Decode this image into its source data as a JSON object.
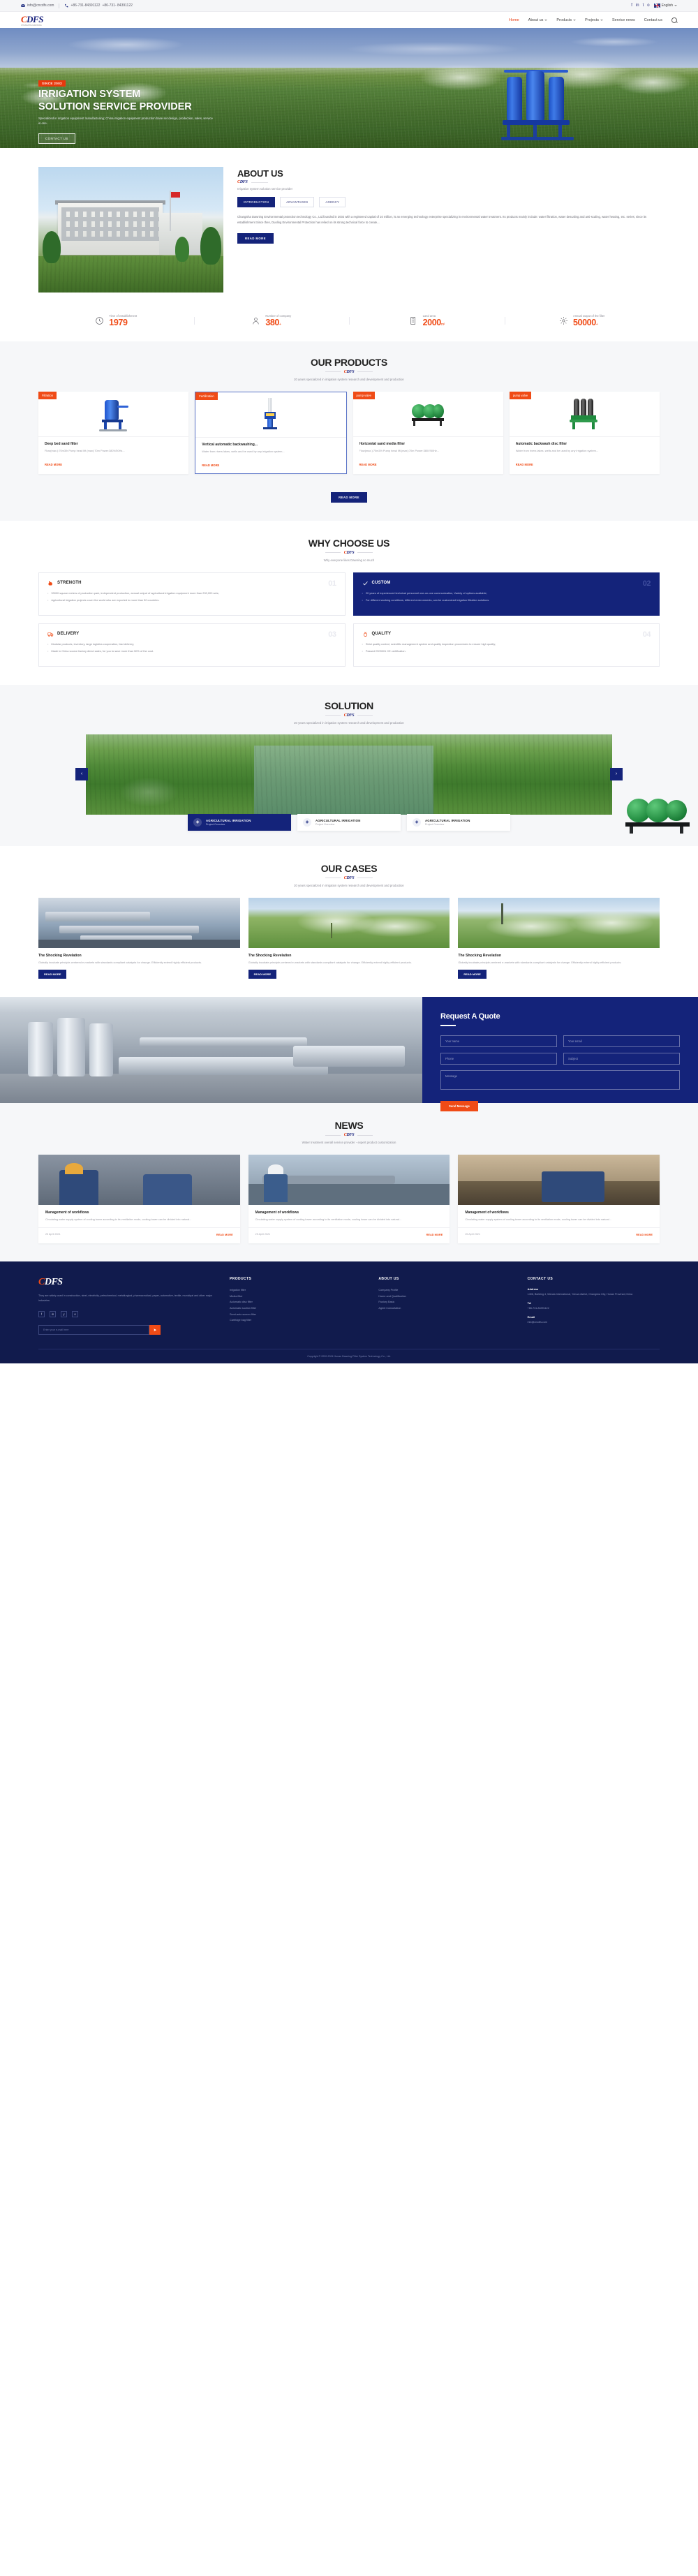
{
  "topbar": {
    "email": "info@cncdfs.com",
    "phone1": "+86-731-84391122",
    "phone2": "+86-731- 84391122",
    "social": [
      "f",
      "in",
      "t",
      "o"
    ],
    "language": "English"
  },
  "nav": {
    "logo": "CDFS",
    "logo_sub": "CHANGSHA DAWNING",
    "items": [
      {
        "label": "Home",
        "has_caret": false,
        "active": true
      },
      {
        "label": "About us",
        "has_caret": true,
        "active": false
      },
      {
        "label": "Products",
        "has_caret": true,
        "active": false
      },
      {
        "label": "Projects",
        "has_caret": true,
        "active": false
      },
      {
        "label": "Service news",
        "has_caret": false,
        "active": false
      },
      {
        "label": "Contact us",
        "has_caret": false,
        "active": false
      }
    ],
    "search_icon": "search-icon"
  },
  "hero": {
    "badge": "SINCE 2002",
    "title_line1": "IRRIGATION SYSTEM",
    "title_line2": "SOLUTION SERVICE PROVIDER",
    "subtitle": "Specialized in irrigation equipment manufacturing; China irrigation equipment production base set design, production, sales, service in one.",
    "button": "CONTACT US"
  },
  "about": {
    "title": "ABOUT US",
    "logo": "CDFS",
    "subtitle": "Irrigation system solution service provider",
    "tabs": [
      {
        "label": "INTRODUCTION",
        "active": true
      },
      {
        "label": "ADVANTAGES",
        "active": false
      },
      {
        "label": "AGENCY",
        "active": false
      }
    ],
    "paragraph": "ChangSha Dawning Environmental protection technology Co., Ltd.founded in 2002 with a registered capital of 10 million, is an emerging technology enterprise specializing in environmental water treatment. Its products mainly include: water filtration, water descaling and anti-scaling, water heating, etc. series; since its establishment Since then, Duoling Environmental Protection has relied on its strong technical force to create...",
    "button": "READ MORE",
    "stats": [
      {
        "label": "Time of establishment",
        "value": "1979",
        "unit": "",
        "icon": "clock-icon"
      },
      {
        "label": "Number of company",
        "value": "380",
        "unit": "+",
        "icon": "person-icon"
      },
      {
        "label": "Land area",
        "value": "2000",
        "unit": "m²",
        "icon": "building-icon"
      },
      {
        "label": "Annual output of the filter",
        "value": "50000",
        "unit": "+",
        "icon": "gear-icon"
      }
    ]
  },
  "products": {
    "title": "OUR PRODUCTS",
    "logo": "CDFS",
    "subtitle": "20 years specialized in irrigation system research and development and production",
    "button": "READ MORE",
    "items": [
      {
        "tag": "Filtration",
        "name": "Deep bed sand filter",
        "desc": "Flow(max.):70m3/h Pump head lift (max):70m Power:380V/50Hz...",
        "more": "READ MORE",
        "selected": false
      },
      {
        "tag": "Fertilization",
        "name": "Vertical automatic backwashing...",
        "desc": "Water from rivers lakes, wells and be used by any irrigation system...",
        "more": "READ MORE",
        "selected": true
      },
      {
        "tag": "pump valve",
        "name": "Horizontal sand media filter",
        "desc": "Flow(max.):70m3/h Pump head lift.(max):70m Power:380V/50Hz...",
        "more": "READ MORE",
        "selected": false
      },
      {
        "tag": "pump valve",
        "name": "Automatic backwash disc filter",
        "desc": "Water from rivers lakes, wells and be used by any irrigation system...",
        "more": "READ MORE",
        "selected": false
      }
    ]
  },
  "why": {
    "title": "WHY CHOOSE US",
    "logo": "CDFS",
    "subtitle": "Why everyone likes Dawning so much",
    "cards": [
      {
        "name": "STRENGTH",
        "num": "01",
        "dark": false,
        "icon": "muscle-icon",
        "points": [
          "33000 square meters of production park, independent production, annual output of agricultural irrigation equipment more than 200,000 sets;",
          "Agricultural irrigation projects cover the world who are exported to more than 50 countries."
        ]
      },
      {
        "name": "CUSTOM",
        "num": "02",
        "dark": true,
        "icon": "check-icon",
        "points": [
          "20 years of experienced technical personnel one-on-one communication, Variety of options available;",
          "For different working conditions, different environments, can be customized irrigation filtration solutions."
        ]
      },
      {
        "name": "DELIVERY",
        "num": "03",
        "dark": false,
        "icon": "truck-icon",
        "points": [
          "Modular products, inventory, large logistics cooperation, fast delivery;",
          "Made in China source factory direct sales, for you to save more than 50% of the cost."
        ]
      },
      {
        "name": "QUALITY",
        "num": "04",
        "dark": false,
        "icon": "medal-icon",
        "points": [
          "Strict quality control, scientific management system and quality inspection procedures to ensure high quality;",
          "Passed ISO9001 CE certification."
        ]
      }
    ]
  },
  "solution": {
    "title": "SOLUTION",
    "logo": "CDFS",
    "subtitle": "20 years specialized in irrigation system research and development and production",
    "prev_icon": "chevron-left-icon",
    "next_icon": "chevron-right-icon",
    "tabs": [
      {
        "label": "AGRICULTURAL IRRIGATION",
        "sub": "Project Overview",
        "active": true
      },
      {
        "label": "AGRICULTURAL IRRIGATION",
        "sub": "Project Overview",
        "active": false
      },
      {
        "label": "AGRICULTURAL IRRIGATION",
        "sub": "Project Overview",
        "active": false
      }
    ]
  },
  "cases": {
    "title": "OUR CASES",
    "logo": "CDFS",
    "subtitle": "20 years specialized in irrigation system research and development and production",
    "items": [
      {
        "title": "The Shocking Revelation",
        "desc": "Globally incubate principle-centered e-markets with standards compliant catalysts for change. Efficiently extend highly efficient products.",
        "button": "READ MORE"
      },
      {
        "title": "The Shocking Revelation",
        "desc": "Globally incubate principle-centered e-markets with standards compliant catalysts for change. Efficiently extend highly efficient products.",
        "button": "READ MORE"
      },
      {
        "title": "The Shocking Revelation",
        "desc": "Globally incubate principle-centered e-markets with standards compliant catalysts for change. Efficiently extend highly efficient products.",
        "button": "READ MORE"
      }
    ]
  },
  "quote": {
    "title": "Request A Quote",
    "fields": {
      "name_placeholder": "Your name",
      "email_placeholder": "Your email",
      "phone_placeholder": "Phone",
      "subject_placeholder": "Subject",
      "message_placeholder": "Message"
    },
    "send_button": "Send Message"
  },
  "news": {
    "title": "NEWS",
    "logo": "CDFS",
    "subtitle": "Water treatment overall service provider - expert product customization",
    "items": [
      {
        "title": "Management of workflows",
        "desc": "Circulating water supply system of cooling tower according to its ventilation mode, cooling tower can be divided into natural...",
        "date": "25 April 2021",
        "more": "READ MORE"
      },
      {
        "title": "Management of workflows",
        "desc": "Circulating water supply system of cooling tower according to its ventilation mode, cooling tower can be divided into natural...",
        "date": "25 April 2021",
        "more": "READ MORE"
      },
      {
        "title": "Management of workflows",
        "desc": "Circulating water supply system of cooling tower according to its ventilation mode, cooling tower can be divided into natural...",
        "date": "25 April 2021",
        "more": "READ MORE"
      }
    ]
  },
  "footer": {
    "logo": "CDFS",
    "desc": "They are widely used in construction, steel, electricity, petrochemical, metallurgical, pharmaceutical, paper, automotive, textile, municipal and other major industries.",
    "social": [
      "f",
      "in",
      "y",
      "o"
    ],
    "subscribe_placeholder": "Enter your e-mail here",
    "subscribe_icon": "send-icon",
    "columns": [
      {
        "title": "PRODUCTS",
        "links": [
          "Irrigation filter",
          "Media filter",
          "Automatic disc filter",
          "Automatic suction filter",
          "Semi-auto screen filter",
          "Cartridge bag filter"
        ]
      },
      {
        "title": "ABOUT US",
        "links": [
          "Company Profile",
          "Home and Qualification",
          "Factory Basic",
          "Agent Consultation"
        ]
      }
    ],
    "contact": {
      "title": "CONTACT US",
      "address_label": "Address",
      "address": "1406, Building 4, Wanda International, Yuhua district, Changsha City, Hunan Province,China",
      "tel_label": "Tel",
      "tel": "+86-731-84391122",
      "email_label": "Email",
      "email": "info@cncdfs.com"
    },
    "copyright": "Copyright © 2020-2024 Hunan Dawning Filter System Technology Co., Ltd."
  }
}
